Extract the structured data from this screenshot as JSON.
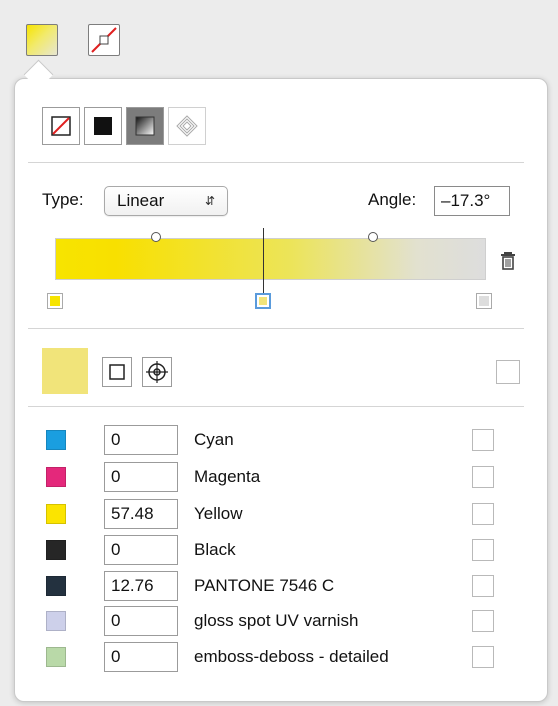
{
  "toolbar": {
    "fill_icon": "gradient-fill-swatch-icon",
    "stroke_icon": "stroke-none-icon"
  },
  "mode_buttons": [
    "none-icon",
    "solid-color-icon",
    "gradient-icon",
    "pattern-icon"
  ],
  "gradient": {
    "type_label": "Type:",
    "type_value": "Linear",
    "angle_label": "Angle:",
    "angle_value": "–17.3°",
    "stops": [
      {
        "color": "#f7e400"
      },
      {
        "color": "#f1e47a"
      },
      {
        "color": "#dddddd"
      }
    ],
    "trash_icon": "trash-icon"
  },
  "color_editor": {
    "current_color": "#f1e47a",
    "buttons": [
      "square-icon",
      "target-icon"
    ]
  },
  "inks": [
    {
      "name": "Cyan",
      "value": "0",
      "color": "#1a9ee0"
    },
    {
      "name": "Magenta",
      "value": "0",
      "color": "#e4287b"
    },
    {
      "name": "Yellow",
      "value": "57.48",
      "color": "#fbe400"
    },
    {
      "name": "Black",
      "value": "0",
      "color": "#262626"
    },
    {
      "name": "PANTONE 7546 C",
      "value": "12.76",
      "color": "#23313f"
    },
    {
      "name": "gloss spot UV varnish",
      "value": "0",
      "color": "#cdd0ea"
    },
    {
      "name": "emboss-deboss - detailed",
      "value": "0",
      "color": "#b9d9a8"
    }
  ]
}
